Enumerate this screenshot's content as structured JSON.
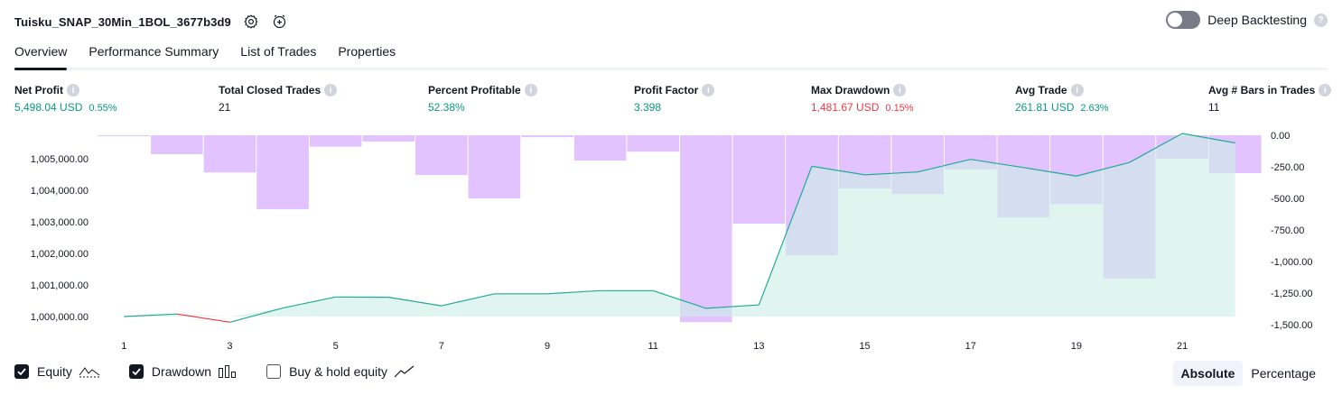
{
  "header": {
    "title": "Tuisku_SNAP_30Min_1BOL_3677b3d9"
  },
  "deep_backtesting": {
    "label": "Deep Backtesting",
    "enabled": false
  },
  "tabs": [
    {
      "label": "Overview",
      "active": true
    },
    {
      "label": "Performance Summary",
      "active": false
    },
    {
      "label": "List of Trades",
      "active": false
    },
    {
      "label": "Properties",
      "active": false
    }
  ],
  "metrics": {
    "net_profit": {
      "label": "Net Profit",
      "value": "5,498.04 USD",
      "pct": "0.55%"
    },
    "total_closed_trades": {
      "label": "Total Closed Trades",
      "value": "21"
    },
    "percent_profitable": {
      "label": "Percent Profitable",
      "value": "52.38%"
    },
    "profit_factor": {
      "label": "Profit Factor",
      "value": "3.398"
    },
    "max_drawdown": {
      "label": "Max Drawdown",
      "value": "1,481.67 USD",
      "pct": "0.15%"
    },
    "avg_trade": {
      "label": "Avg Trade",
      "value": "261.81 USD",
      "pct": "2.63%"
    },
    "avg_bars": {
      "label": "Avg # Bars in Trades",
      "value": "11"
    }
  },
  "chart_data": {
    "type": "line",
    "x": [
      1,
      2,
      3,
      4,
      5,
      6,
      7,
      8,
      9,
      10,
      11,
      12,
      13,
      14,
      15,
      16,
      17,
      18,
      19,
      20,
      21,
      22
    ],
    "x_tick_labels": [
      "1",
      "3",
      "5",
      "7",
      "9",
      "11",
      "13",
      "15",
      "17",
      "19",
      "21"
    ],
    "series": [
      {
        "name": "Equity",
        "axis": "left",
        "type": "area",
        "values": [
          1000000,
          1000080,
          999820,
          1000270,
          1000620,
          1000610,
          1000340,
          1000720,
          1000720,
          1000820,
          1000820,
          1000260,
          1000370,
          1004760,
          1004490,
          1004580,
          1004980,
          1004720,
          1004450,
          1004880,
          1005800,
          1005500
        ]
      },
      {
        "name": "Drawdown",
        "axis": "right",
        "type": "bar",
        "values": [
          -5,
          -150,
          -295,
          -585,
          -90,
          -50,
          -315,
          -500,
          -15,
          -200,
          -130,
          -1480,
          -700,
          -950,
          -420,
          -465,
          -270,
          -650,
          -545,
          -1135,
          -185,
          -300
        ]
      }
    ],
    "left_axis": {
      "ylim": [
        999400,
        1005200
      ],
      "ticks": [
        "1,000,000.00",
        "1,001,000.00",
        "1,002,000.00",
        "1,003,000.00",
        "1,004,000.00",
        "1,005,000.00"
      ]
    },
    "right_axis": {
      "ylim": [
        -1500,
        0
      ],
      "ticks": [
        "0.00",
        "-250.00",
        "-500.00",
        "-750.00",
        "-1,000.00",
        "-1,250.00",
        "-1,500.00"
      ]
    },
    "colors": {
      "equity_line": "#22ab94",
      "equity_below_start": "#f23645",
      "equity_fill": "#cdeee6",
      "drawdown_bar": "#e2c2ff"
    },
    "grid": false
  },
  "legend": [
    {
      "label": "Equity",
      "checked": true,
      "icon": "equity-line-icon"
    },
    {
      "label": "Drawdown",
      "checked": true,
      "icon": "drawdown-bars-icon"
    },
    {
      "label": "Buy & hold equity",
      "checked": false,
      "icon": "buy-hold-line-icon"
    }
  ],
  "modes": [
    {
      "label": "Absolute",
      "active": true
    },
    {
      "label": "Percentage",
      "active": false
    }
  ]
}
